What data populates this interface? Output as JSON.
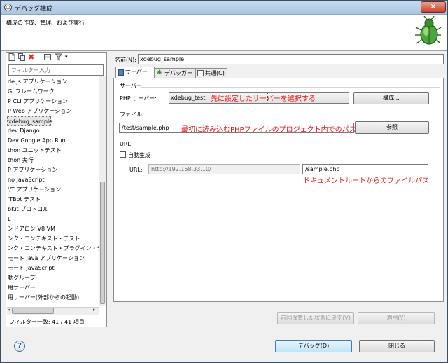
{
  "window": {
    "title": "デバッグ構成",
    "close": "×"
  },
  "banner": {
    "text": "構成の作成、管理、および実行"
  },
  "left": {
    "filter_placeholder": "フィルター入力",
    "items": [
      "de.js アプリケーション",
      "Gi フレームワーク",
      "P CLI アプリケーション",
      "P Web アプリケーション",
      "xdebug_sample",
      "dev Django",
      "Dev Google App Run",
      "thon ユニットテスト",
      "thon 実行",
      "P アプリケーション",
      "no JavaScript",
      "'/T アプリケーション",
      "'TBot テスト",
      "bKit プロトコル",
      "L",
      "ンドアロン V8 VM",
      "ンク・コンテキスト・テスト",
      "ンク・コンテキスト・プラグイン・テ",
      "モート Java アプリケーション",
      "モート JavaScript",
      "動グループ",
      "用サーバー",
      "用サーバー(外部からの起動)"
    ],
    "selected_index": 4,
    "filter_count": "フィルター一致: 41 / 41 項目"
  },
  "right": {
    "name_label": "名前(N):",
    "name_value": "xdebug_sample",
    "tabs": [
      "サーバー",
      "デバッガー",
      "共通(C)"
    ],
    "server_group": "サーバー",
    "php_server_label": "PHP サーバー:",
    "php_server_value": "xdebug_test",
    "configure_button": "構成...",
    "file_group": "ファイル",
    "file_value": "/test/sample.php",
    "browse_button": "参照",
    "url_group": "URL",
    "auto_generate_label": "自動生成",
    "url_label": "URL:",
    "url_base": "http://192.168.33.10/",
    "url_path": "/sample.php",
    "revert_button": "前回保管した状態に戻す(V)",
    "apply_button": "適用(Y)"
  },
  "annotations": {
    "server": "先に設定したサーバーを選択する",
    "file": "最初に読み込むPHPファイルのプロジェクト内でのパス",
    "url": "ドキュメントルートからのファイルパス"
  },
  "footer": {
    "help": "?",
    "debug_button": "デバッグ(D)",
    "close_button": "閉じる"
  },
  "colors": {
    "annotation": "#e81a1a",
    "primary_button": "#bee6fd"
  }
}
